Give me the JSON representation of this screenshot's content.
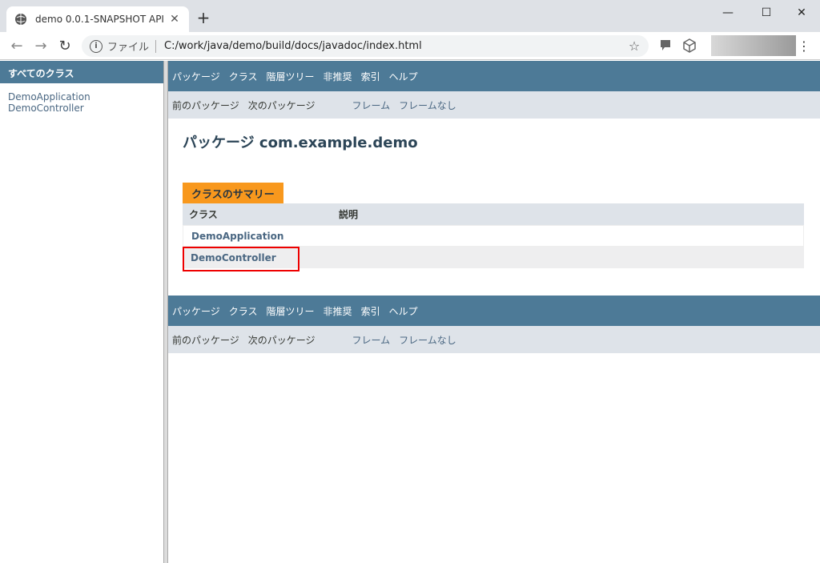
{
  "browser": {
    "tab_title": "demo 0.0.1-SNAPSHOT API",
    "tab_close": "✕",
    "newtab": "+",
    "scheme_label": "ファイル",
    "url": "C:/work/java/demo/build/docs/javadoc/index.html",
    "minimize": "—",
    "maximize": "☐",
    "close": "✕"
  },
  "left": {
    "header": "すべてのクラス",
    "classes": [
      "DemoApplication",
      "DemoController"
    ]
  },
  "nav": {
    "items": [
      "パッケージ",
      "クラス",
      "階層ツリー",
      "非推奨",
      "索引",
      "ヘルプ"
    ],
    "prev_pkg": "前のパッケージ",
    "next_pkg": "次のパッケージ",
    "frames": "フレーム",
    "no_frames": "フレームなし"
  },
  "main": {
    "title": "パッケージ com.example.demo",
    "summary_caption": "クラスのサマリー",
    "col_class": "クラス",
    "col_desc": "説明",
    "rows": [
      "DemoApplication",
      "DemoController"
    ]
  },
  "colors": {
    "nav_bar": "#4d7a97",
    "sub_nav": "#dee3e9",
    "caption": "#f8981d",
    "highlight": "#ee0000"
  }
}
